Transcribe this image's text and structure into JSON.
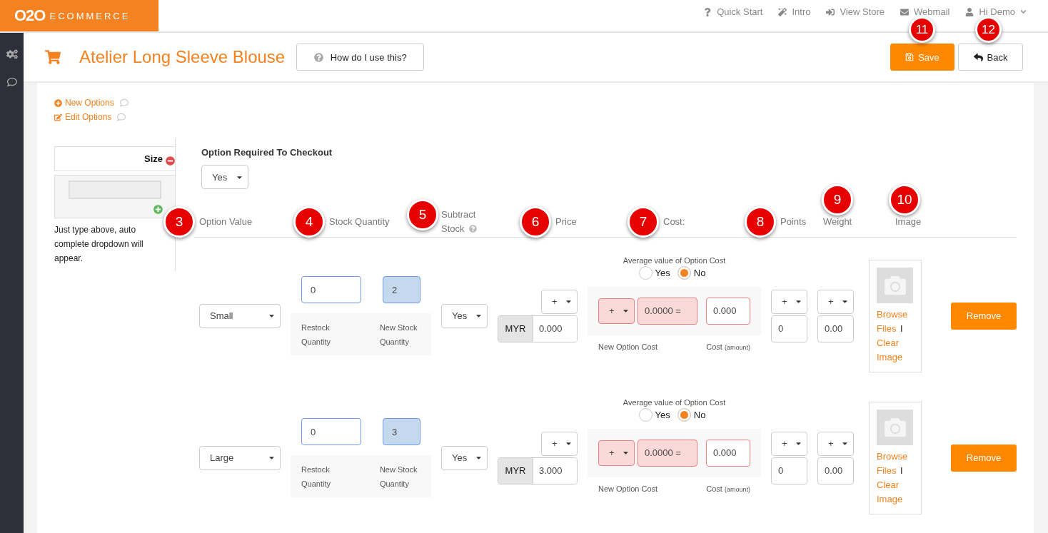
{
  "brand": {
    "mark": "O2O",
    "text": "ECOMMERCE"
  },
  "top_nav": [
    {
      "label": "Quick Start"
    },
    {
      "label": "Intro"
    },
    {
      "label": "View Store"
    },
    {
      "label": "Webmail"
    },
    {
      "label": "Hi Demo"
    }
  ],
  "header": {
    "title": "Atelier Long Sleeve Blouse",
    "help_button": "How do I use this?",
    "save_button": {
      "label": "Save",
      "callout": "11"
    },
    "back_button": {
      "label": "Back",
      "callout": "12"
    }
  },
  "option_links": [
    "New Options",
    "Edit Options"
  ],
  "option_group": {
    "name": "Size",
    "hint": "Just type above, auto complete dropdown will appear."
  },
  "required": {
    "label": "Option Required To Checkout",
    "value": "Yes"
  },
  "columns": [
    {
      "label": "Option Value",
      "callout": "3"
    },
    {
      "label": "Stock Quantity",
      "callout": "4"
    },
    {
      "label": "Subtract Stock",
      "callout": "5",
      "help": true
    },
    {
      "label": "Price",
      "callout": "6"
    },
    {
      "label": "Cost:",
      "callout": "7"
    },
    {
      "label": "Points",
      "callout": "8"
    },
    {
      "label": "Weight",
      "callout": "9"
    },
    {
      "label": "Image",
      "callout": "10"
    }
  ],
  "rows": [
    {
      "option_value": "Small",
      "restock": "0",
      "new_stock": "2",
      "restock_label": "Restock Quantity",
      "new_stock_label": "New Stock Quantity",
      "subtract": "Yes",
      "price_sign": "+",
      "currency": "MYR",
      "price": "0.000",
      "avg_label": "Average value of Option Cost",
      "avg_options": [
        {
          "label": "Yes",
          "selected": false
        },
        {
          "label": "No",
          "selected": true
        }
      ],
      "cost_sign": "+",
      "cost_value": "0.0000 =",
      "cost_amount": "0.000",
      "new_cost_label": "New Option Cost",
      "cost_label": "Cost",
      "cost_unit": "(amount)",
      "points_sign": "+",
      "points": "0",
      "weight_sign": "+",
      "weight": "0.00",
      "browse": "Browse Files",
      "separator": "I",
      "clear": "Clear Image",
      "remove": "Remove"
    },
    {
      "option_value": "Large",
      "restock": "0",
      "new_stock": "3",
      "restock_label": "Restock Quantity",
      "new_stock_label": "New Stock Quantity",
      "subtract": "Yes",
      "price_sign": "+",
      "currency": "MYR",
      "price": "3.000",
      "avg_label": "Average value of Option Cost",
      "avg_options": [
        {
          "label": "Yes",
          "selected": false
        },
        {
          "label": "No",
          "selected": true
        }
      ],
      "cost_sign": "+",
      "cost_value": "0.0000 =",
      "cost_amount": "0.000",
      "new_cost_label": "New Option Cost",
      "cost_label": "Cost",
      "cost_unit": "(amount)",
      "points_sign": "+",
      "points": "0",
      "weight_sign": "+",
      "weight": "0.00",
      "browse": "Browse Files",
      "separator": "I",
      "clear": "Clear Image",
      "remove": "Remove"
    }
  ]
}
